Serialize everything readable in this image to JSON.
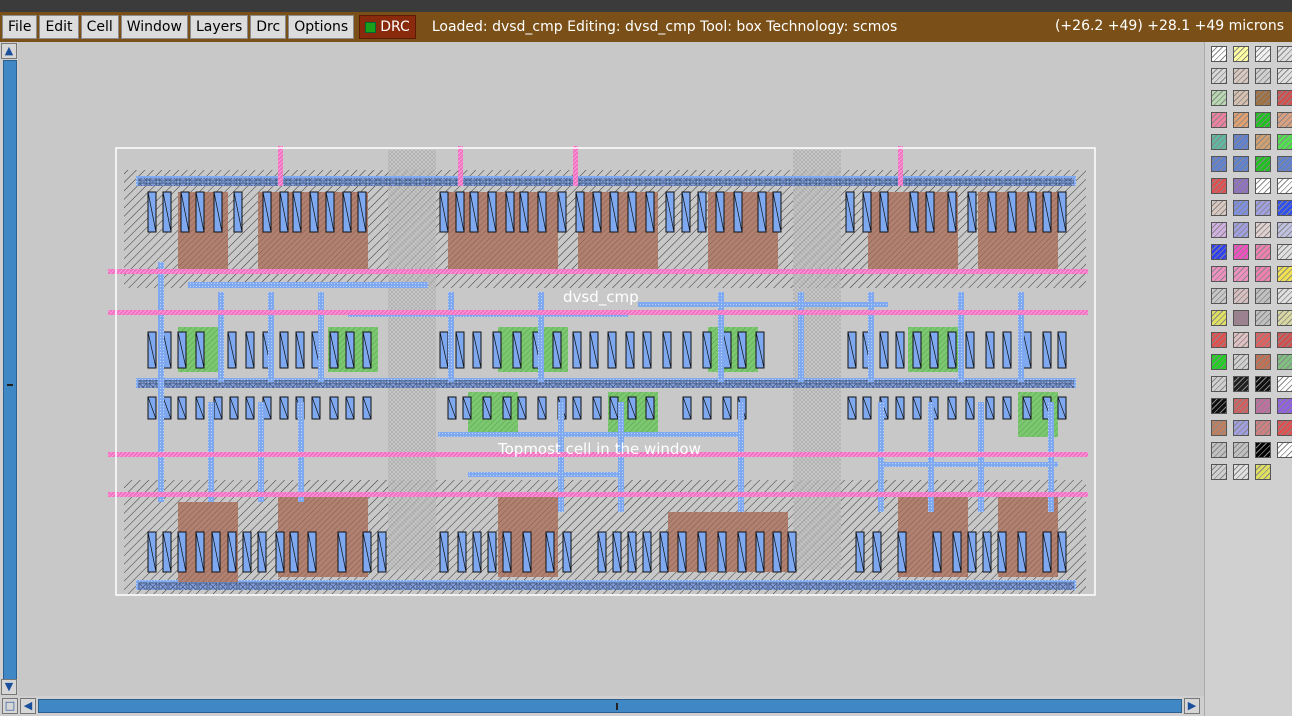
{
  "menu": {
    "items": [
      {
        "name": "menu-file",
        "label": "File"
      },
      {
        "name": "menu-edit",
        "label": "Edit"
      },
      {
        "name": "menu-cell",
        "label": "Cell"
      },
      {
        "name": "menu-window",
        "label": "Window"
      },
      {
        "name": "menu-layers",
        "label": "Layers"
      },
      {
        "name": "menu-drc",
        "label": "Drc"
      },
      {
        "name": "menu-options",
        "label": "Options"
      }
    ],
    "drc_button_label": "DRC",
    "status": "Loaded: dvsd_cmp Editing: dvsd_cmp Tool: box  Technology: scmos",
    "coordinates": "(+26.2 +49) +28.1 +49 microns"
  },
  "layout": {
    "cell_label": "dvsd_cmp",
    "topmost_label": "Topmost cell in the window"
  },
  "colors": {
    "menubar": "#7a5018",
    "drc": "#8a2a0c",
    "metal1": "#7ea8f0",
    "poly": "#f070c0",
    "diffusion": "#b08070",
    "ndiff": "#7cc870",
    "scroll": "#3f88c5"
  },
  "palette": {
    "swatch_colors": [
      "#ffffff",
      "#ffffa0",
      "#f0f0f0",
      "#e0e0e0",
      "#d8d8d8",
      "#d8c8c0",
      "#d0d0d0",
      "#e0e0e0",
      "#b8d8b0",
      "#d8c0b0",
      "#a07040",
      "#d05050",
      "#f080a0",
      "#e0a070",
      "#20c020",
      "#d8a080",
      "#60b8a0",
      "#6080d0",
      "#d0a070",
      "#50e050",
      "#6080d0",
      "#6080d0",
      "#20c020",
      "#6080d0",
      "#e05050",
      "#9070c0",
      "#ffffff",
      "#ffffff",
      "#d8c8c0",
      "#8090e0",
      "#a0a0e0",
      "#3050f0",
      "#d0b0e0",
      "#a0a0e0",
      "#e0d0d0",
      "#c0c0e0",
      "#3040f0",
      "#f050c0",
      "#f080b0",
      "#e0e0e0",
      "#f090c0",
      "#f090c0",
      "#f080b0",
      "#f0e050",
      "#c8c8c8",
      "#d8c0c0",
      "#c0c0c0",
      "#e0e0e0",
      "#e0e060",
      "#a08090",
      "#c0c0c0",
      "#d8d8a0",
      "#e05050",
      "#e0c0c0",
      "#e06060",
      "#d05050",
      "#20d020",
      "#d0d0d0",
      "#c07050",
      "#80c080",
      "#d0d0d0",
      "#202020",
      "#101010",
      "#ffffff",
      "#101010",
      "#d06060",
      "#c070a0",
      "#9060e0",
      "#c08060",
      "#a0a0e0",
      "#d08080",
      "#e05050",
      "#c0c0c0",
      "#c0c0c0",
      "#000000",
      "#ffffff",
      "#d0d0d0",
      "#e0e0e0",
      "#e0e060"
    ]
  }
}
